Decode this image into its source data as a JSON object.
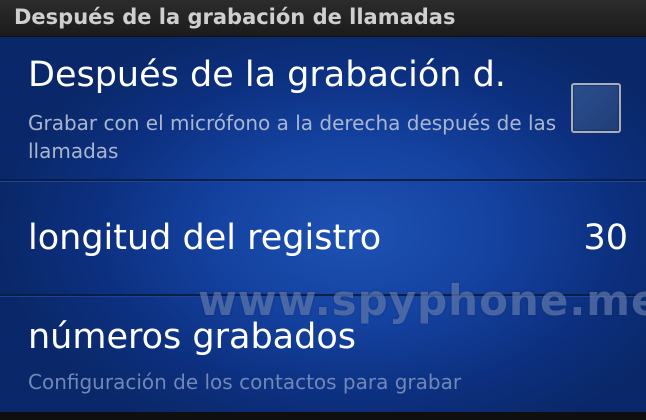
{
  "header": {
    "title": "Después de la grabación de llamadas"
  },
  "items": [
    {
      "title": "Después de la grabación d.",
      "summary": "Grabar con el micrófono a la derecha después de las llamadas",
      "checked": false
    },
    {
      "title": "longitud del registro",
      "value": "30"
    },
    {
      "title": "números grabados",
      "summary": "Configuración de los contactos para grabar"
    }
  ],
  "watermark": "www.spyphone.me"
}
